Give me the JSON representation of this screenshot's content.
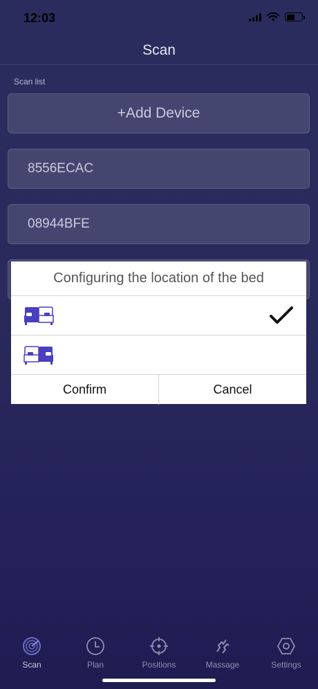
{
  "status": {
    "time": "12:03",
    "battery_level": 0.55
  },
  "header": {
    "title": "Scan"
  },
  "scan_list": {
    "label": "Scan list",
    "add_device_label": "+Add Device",
    "devices": [
      "8556ECAC",
      "08944BFE"
    ]
  },
  "dialog": {
    "title": "Configuring the location of the bed",
    "options": [
      {
        "icon": "bed-left-side-icon",
        "selected": true
      },
      {
        "icon": "bed-right-side-icon",
        "selected": false
      }
    ],
    "confirm_label": "Confirm",
    "cancel_label": "Cancel"
  },
  "tabs": [
    {
      "label": "Scan",
      "icon": "radar-icon",
      "active": true
    },
    {
      "label": "Plan",
      "icon": "clock-icon",
      "active": false
    },
    {
      "label": "Positions",
      "icon": "crosshair-icon",
      "active": false
    },
    {
      "label": "Massage",
      "icon": "wave-icon",
      "active": false
    },
    {
      "label": "Settings",
      "icon": "hexagon-settings-icon",
      "active": false
    }
  ],
  "colors": {
    "background": "#2a2b5c",
    "card": "#45466f",
    "bed_highlight": "#4a3fbf",
    "dialog": "#ffffff"
  }
}
